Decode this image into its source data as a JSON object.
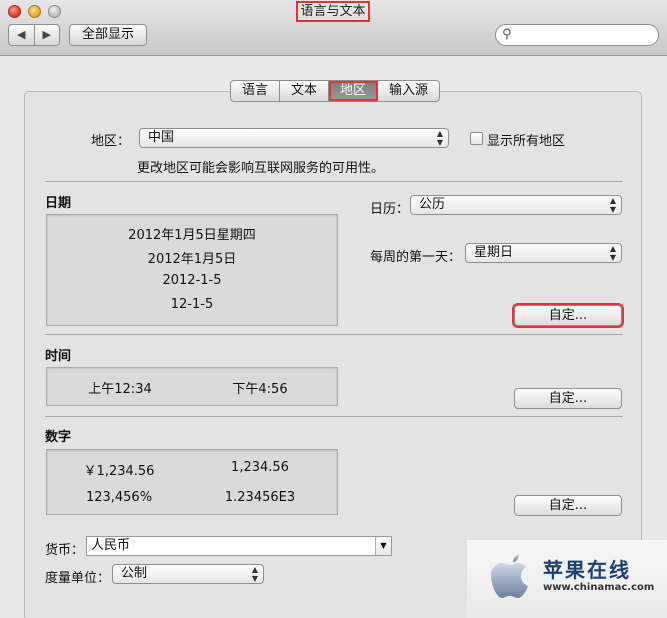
{
  "window": {
    "title": "语言与文本"
  },
  "toolbar": {
    "back": "◀",
    "forward": "▶",
    "show_all": "全部显示",
    "search_placeholder": ""
  },
  "tabs": [
    {
      "label": "语言",
      "active": false
    },
    {
      "label": "文本",
      "active": false
    },
    {
      "label": "地区",
      "active": true
    },
    {
      "label": "输入源",
      "active": false
    }
  ],
  "region": {
    "label": "地区：",
    "value": "中国",
    "show_all_label": "显示所有地区",
    "show_all_checked": false,
    "note": "更改地区可能会影响互联网服务的可用性。"
  },
  "date": {
    "heading": "日期",
    "samples": [
      "2012年1月5日星期四",
      "2012年1月5日",
      "2012-1-5",
      "12-1-5"
    ],
    "calendar_label": "日历：",
    "calendar_value": "公历",
    "first_day_label": "每周的第一天：",
    "first_day_value": "星期日",
    "customize": "自定..."
  },
  "time": {
    "heading": "时间",
    "samples": [
      "上午12:34",
      "下午4:56"
    ],
    "customize": "自定..."
  },
  "numbers": {
    "heading": "数字",
    "samples": [
      "￥1,234.56",
      "1,234.56",
      "123,456%",
      "1.23456E3"
    ],
    "customize": "自定..."
  },
  "currency": {
    "label": "货币：",
    "value": "人民币"
  },
  "units": {
    "label": "度量单位：",
    "value": "公制"
  },
  "watermark": {
    "brand": "苹果在线",
    "url": "www.chinamac.com"
  },
  "colors": {
    "highlight": "#e0343c",
    "active_tab": "#8a8a8a"
  }
}
